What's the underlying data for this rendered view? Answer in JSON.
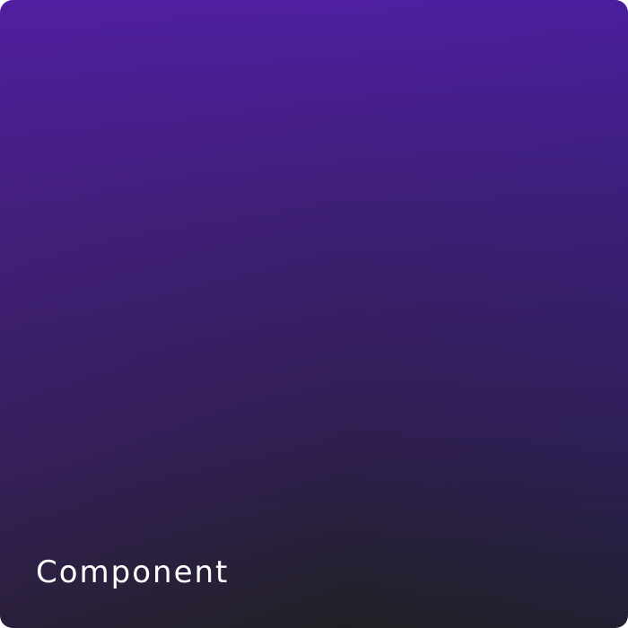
{
  "card": {
    "label": "Component"
  },
  "colors": {
    "gradient_top": "#4f1fa0",
    "gradient_bottom": "#202024",
    "label_color": "#ffffff"
  }
}
